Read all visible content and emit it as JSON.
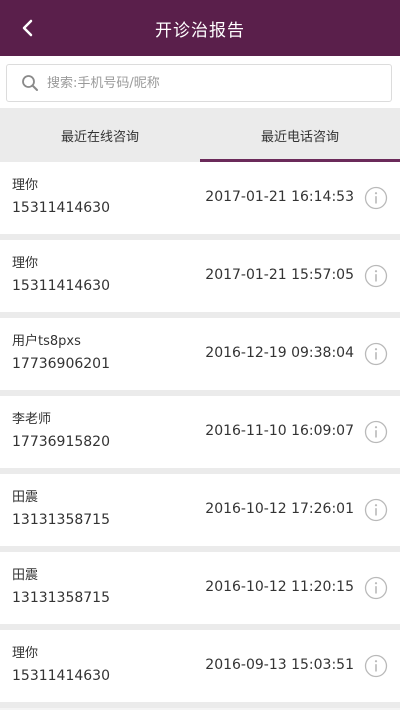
{
  "header": {
    "title": "开诊治报告"
  },
  "search": {
    "placeholder": "搜索:手机号码/昵称"
  },
  "tabs": [
    {
      "label": "最近在线咨询",
      "active": false
    },
    {
      "label": "最近电话咨询",
      "active": true
    }
  ],
  "records": [
    {
      "name": "理你",
      "phone": "15311414630",
      "time": "2017-01-21 16:14:53"
    },
    {
      "name": "理你",
      "phone": "15311414630",
      "time": "2017-01-21 15:57:05"
    },
    {
      "name": "用户ts8pxs",
      "phone": "17736906201",
      "time": "2016-12-19 09:38:04"
    },
    {
      "name": "李老师",
      "phone": "17736915820",
      "time": "2016-11-10 16:09:07"
    },
    {
      "name": "田震",
      "phone": "13131358715",
      "time": "2016-10-12 17:26:01"
    },
    {
      "name": "田震",
      "phone": "13131358715",
      "time": "2016-10-12 11:20:15"
    },
    {
      "name": "理你",
      "phone": "15311414630",
      "time": "2016-09-13 15:03:51"
    }
  ],
  "colors": {
    "header_bg": "#5a1f4b",
    "accent": "#6b2a5a"
  }
}
